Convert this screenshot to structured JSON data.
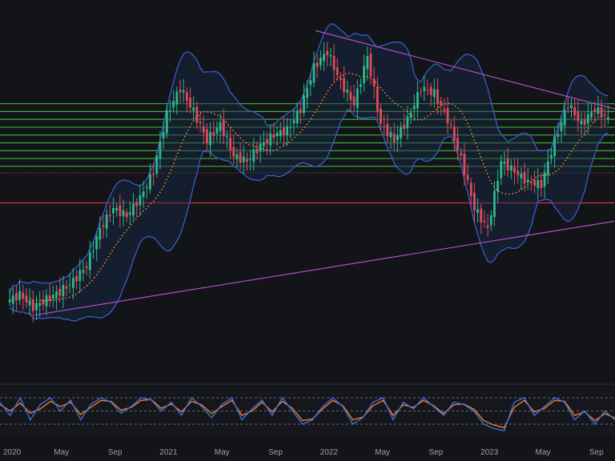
{
  "colors": {
    "background": "#121418",
    "up": "#2eb88a",
    "down": "#e34a5a",
    "bb_band": "#3b62d6",
    "bb_fill": "#1a2a4a",
    "bb_basis": "#f08a24",
    "support_lines": "#3fae3f",
    "red_line": "#d0313d",
    "trendline": "#b04ec8",
    "osc_k": "#3b6fd9",
    "osc_d": "#f07a2a",
    "osc_guides": "#7d8590"
  },
  "chart_data": {
    "type": "candlestick",
    "title": "",
    "x_axis": {
      "labels": [
        "2020",
        "May",
        "Sep",
        "2021",
        "May",
        "Sep",
        "2022",
        "May",
        "Sep",
        "2023",
        "May",
        "Sep"
      ],
      "label_dates": [
        "2020-01",
        "2020-05",
        "2020-09",
        "2021-01",
        "2021-05",
        "2021-09",
        "2022-01",
        "2022-05",
        "2022-09",
        "2023-01",
        "2023-05",
        "2023-09"
      ]
    },
    "y_range": [
      0,
      100
    ],
    "price_series": [
      {
        "date": "2020-01",
        "close": 10
      },
      {
        "date": "2020-02",
        "close": 13
      },
      {
        "date": "2020-03",
        "close": 8
      },
      {
        "date": "2020-04",
        "close": 11
      },
      {
        "date": "2020-05",
        "close": 14
      },
      {
        "date": "2020-06",
        "close": 18
      },
      {
        "date": "2020-07",
        "close": 24
      },
      {
        "date": "2020-08",
        "close": 38
      },
      {
        "date": "2020-09",
        "close": 46
      },
      {
        "date": "2020-10",
        "close": 43
      },
      {
        "date": "2020-11",
        "close": 50
      },
      {
        "date": "2020-12",
        "close": 60
      },
      {
        "date": "2021-01",
        "close": 82
      },
      {
        "date": "2021-02",
        "close": 92
      },
      {
        "date": "2021-03",
        "close": 83
      },
      {
        "date": "2021-04",
        "close": 72
      },
      {
        "date": "2021-05",
        "close": 78
      },
      {
        "date": "2021-06",
        "close": 66
      },
      {
        "date": "2021-07",
        "close": 64
      },
      {
        "date": "2021-08",
        "close": 70
      },
      {
        "date": "2021-09",
        "close": 74
      },
      {
        "date": "2021-10",
        "close": 76
      },
      {
        "date": "2021-11",
        "close": 84
      },
      {
        "date": "2021-12",
        "close": 100
      },
      {
        "date": "2022-01",
        "close": 106
      },
      {
        "date": "2022-02",
        "close": 94
      },
      {
        "date": "2022-03",
        "close": 86
      },
      {
        "date": "2022-04",
        "close": 104
      },
      {
        "date": "2022-05",
        "close": 78
      },
      {
        "date": "2022-06",
        "close": 72
      },
      {
        "date": "2022-07",
        "close": 80
      },
      {
        "date": "2022-08",
        "close": 92
      },
      {
        "date": "2022-09",
        "close": 90
      },
      {
        "date": "2022-10",
        "close": 80
      },
      {
        "date": "2022-11",
        "close": 65
      },
      {
        "date": "2022-12",
        "close": 46
      },
      {
        "date": "2023-01",
        "close": 38
      },
      {
        "date": "2023-02",
        "close": 64
      },
      {
        "date": "2023-03",
        "close": 60
      },
      {
        "date": "2023-04",
        "close": 56
      },
      {
        "date": "2023-05",
        "close": 55
      },
      {
        "date": "2023-06",
        "close": 72
      },
      {
        "date": "2023-07",
        "close": 86
      },
      {
        "date": "2023-08",
        "close": 78
      },
      {
        "date": "2023-09",
        "close": 84
      },
      {
        "date": "2023-10",
        "close": 80
      }
    ],
    "horizontal_levels_green": [
      86,
      83,
      80,
      77,
      74,
      71,
      68,
      65,
      62
    ],
    "horizontal_level_red": 48,
    "trendlines": [
      {
        "name": "descending",
        "from": {
          "date": "2021-12",
          "value": 114
        },
        "to": {
          "date": "2023-10",
          "value": 84
        }
      },
      {
        "name": "ascending",
        "from": {
          "date": "2020-03",
          "value": 5
        },
        "to": {
          "date": "2023-10",
          "value": 41
        }
      }
    ],
    "oscillator": {
      "levels": [
        80,
        50,
        20
      ],
      "k": [
        70,
        40,
        80,
        30,
        65,
        80,
        50,
        75,
        30,
        65,
        80,
        70,
        45,
        60,
        80,
        75,
        50,
        70,
        40,
        80,
        60,
        35,
        65,
        80,
        30,
        55,
        75,
        40,
        80,
        50,
        20,
        30,
        60,
        80,
        60,
        20,
        35,
        70,
        80,
        30,
        70,
        55,
        80,
        60,
        40,
        70,
        65,
        50,
        20,
        10,
        5,
        70,
        80,
        40,
        60,
        80,
        70,
        30,
        50,
        20,
        50,
        30
      ],
      "d": [
        65,
        50,
        68,
        45,
        55,
        72,
        60,
        70,
        42,
        58,
        74,
        72,
        52,
        58,
        74,
        76,
        56,
        66,
        48,
        72,
        64,
        44,
        60,
        74,
        40,
        50,
        70,
        48,
        72,
        56,
        28,
        32,
        55,
        74,
        62,
        30,
        36,
        62,
        74,
        40,
        64,
        58,
        74,
        62,
        44,
        64,
        66,
        54,
        28,
        18,
        12,
        58,
        74,
        48,
        56,
        74,
        72,
        40,
        48,
        28,
        44,
        34
      ]
    }
  }
}
